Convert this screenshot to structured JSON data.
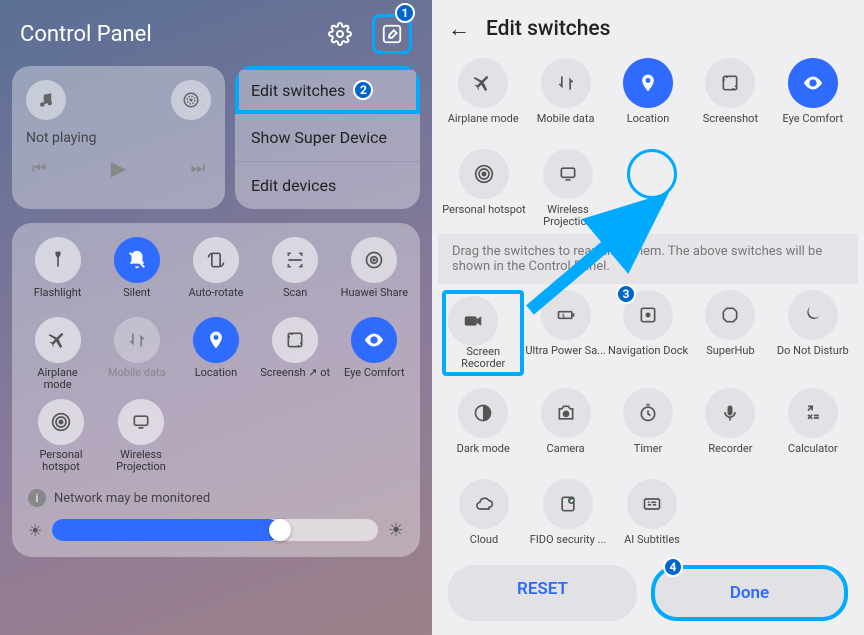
{
  "left": {
    "title": "Control Panel",
    "media": {
      "status": "Not playing"
    },
    "menu": {
      "edit_switches": "Edit switches",
      "show_super_device": "Show Super Device",
      "edit_devices": "Edit devices"
    },
    "switches_row1": [
      {
        "label": "Flashlight",
        "icon": "flashlight",
        "active": false
      },
      {
        "label": "Silent",
        "icon": "bell-off",
        "active": true
      },
      {
        "label": "Auto-rotate",
        "icon": "rotate",
        "active": false
      },
      {
        "label": "Scan",
        "icon": "scan",
        "active": false
      },
      {
        "label": "Huawei Share",
        "icon": "share",
        "active": false
      }
    ],
    "switches_row2": [
      {
        "label": "Airplane mode",
        "icon": "airplane",
        "active": false
      },
      {
        "label": "Mobile data",
        "icon": "data",
        "active": false,
        "disabled": true
      },
      {
        "label": "Location",
        "icon": "location",
        "active": true
      },
      {
        "label": "Screensh ↗ ot",
        "icon": "screenshot",
        "active": false
      },
      {
        "label": "Eye Comfort",
        "icon": "eye",
        "active": true
      }
    ],
    "switches_row3": [
      {
        "label": "Personal hotspot",
        "icon": "hotspot",
        "active": false
      },
      {
        "label": "Wireless Projection",
        "icon": "cast",
        "active": false
      }
    ],
    "network_warning": "Network may be monitored",
    "brightness_pct": 70
  },
  "right": {
    "title": "Edit switches",
    "top_row1": [
      {
        "label": "Airplane mode",
        "icon": "airplane"
      },
      {
        "label": "Mobile data",
        "icon": "data",
        "disabled": true
      },
      {
        "label": "Location",
        "icon": "location",
        "active": true
      },
      {
        "label": "Screenshot",
        "icon": "screenshot"
      },
      {
        "label": "Eye Comfort",
        "icon": "eye",
        "active": true
      }
    ],
    "top_row2": [
      {
        "label": "Personal hotspot",
        "icon": "hotspot"
      },
      {
        "label": "Wireless Projection",
        "icon": "cast"
      }
    ],
    "drag_note": "Drag the switches to rearrange them. The above switches will be shown in the Control Panel.",
    "bot_row1": [
      {
        "label": "Screen Recorder",
        "icon": "video",
        "highlight": true
      },
      {
        "label": "Ultra Power Sa...",
        "icon": "battery"
      },
      {
        "label": "Navigation Dock",
        "icon": "navdock"
      },
      {
        "label": "SuperHub",
        "icon": "superhub"
      },
      {
        "label": "Do Not Disturb",
        "icon": "moon"
      }
    ],
    "bot_row2": [
      {
        "label": "Dark mode",
        "icon": "dark"
      },
      {
        "label": "Camera",
        "icon": "camera"
      },
      {
        "label": "Timer",
        "icon": "timer"
      },
      {
        "label": "Recorder",
        "icon": "mic"
      },
      {
        "label": "Calculator",
        "icon": "calc"
      }
    ],
    "bot_row3": [
      {
        "label": "Cloud",
        "icon": "cloud"
      },
      {
        "label": "FIDO security ...",
        "icon": "fido"
      },
      {
        "label": "AI Subtitles",
        "icon": "subtitles"
      }
    ],
    "reset": "RESET",
    "done": "Done"
  },
  "callouts": {
    "c1": "1",
    "c2": "2",
    "c3": "3",
    "c4": "4"
  }
}
